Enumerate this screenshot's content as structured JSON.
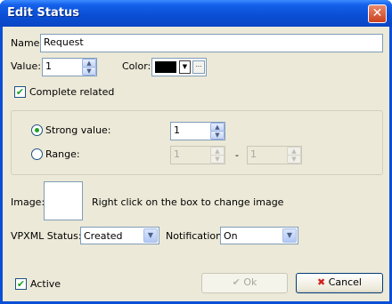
{
  "window": {
    "title": "Edit Status",
    "close_glyph": "✕"
  },
  "name_field": {
    "label": "Name",
    "value": "Request"
  },
  "value_field": {
    "label": "Value:",
    "value": "1"
  },
  "color_field": {
    "label": "Color:",
    "value": "#000000",
    "ellipsis": "···"
  },
  "complete_related": {
    "label": "Complete related",
    "checked": true
  },
  "strong_value": {
    "label": "Strong value:",
    "value": "1",
    "selected": true
  },
  "range": {
    "label": "Range:",
    "from": "1",
    "to": "1",
    "separator": "-"
  },
  "image": {
    "label": "Image:",
    "hint": "Right click on the box to  change image"
  },
  "vpxml_status": {
    "label": "VPXML Status:",
    "value": "Created"
  },
  "notification": {
    "label": "Notification:",
    "value": "On"
  },
  "active": {
    "label": "Active",
    "checked": true
  },
  "buttons": {
    "ok_label": "Ok",
    "cancel_label": "Cancel"
  },
  "icons": {
    "check_glyph": "✔",
    "cross_glyph": "✖",
    "up_glyph": "▲",
    "down_glyph": "▼"
  },
  "colors": {
    "title_bar": "#0a4fd6",
    "dialog_bg": "#ece9d8",
    "check_green": "#21a121",
    "cancel_red": "#d0201a"
  }
}
